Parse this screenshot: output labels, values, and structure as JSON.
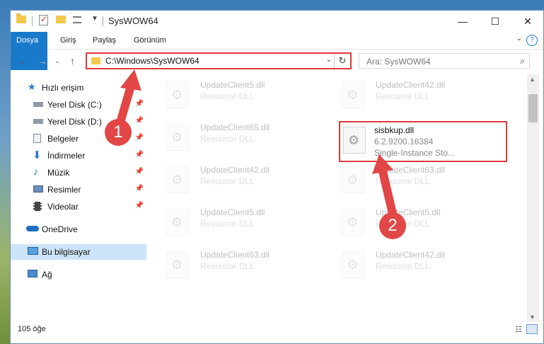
{
  "window": {
    "title": "SysWOW64"
  },
  "ribbon": {
    "tabs": [
      "Dosya",
      "Giriş",
      "Paylaş",
      "Görünüm"
    ]
  },
  "nav": {
    "address": "C:\\Windows\\SysWOW64",
    "search_placeholder": "Ara: SysWOW64"
  },
  "sidebar": {
    "quick_access": "Hızlı erişim",
    "items": [
      {
        "label": "Yerel Disk (C:)",
        "icon": "drive-icon"
      },
      {
        "label": "Yerel Disk (D:)",
        "icon": "drive-icon"
      },
      {
        "label": "Belgeler",
        "icon": "documents-icon"
      },
      {
        "label": "İndirmeler",
        "icon": "download-icon"
      },
      {
        "label": "Müzik",
        "icon": "music-icon"
      },
      {
        "label": "Resimler",
        "icon": "pictures-icon"
      },
      {
        "label": "Videolar",
        "icon": "video-icon"
      }
    ],
    "onedrive": "OneDrive",
    "this_pc": "Bu bilgisayar",
    "network": "Ağ"
  },
  "files": {
    "left": [
      {
        "name": "UpdateClient5.dll",
        "desc": "Resource DLL"
      },
      {
        "name": "UpdateClient65.dll",
        "desc": "Resource DLL"
      },
      {
        "name": "UpdateClient42.dll",
        "desc": "Resource DLL"
      },
      {
        "name": "UpdateClient5.dll",
        "desc": "Resource DLL"
      },
      {
        "name": "UpdateClient63.dll",
        "desc": "Resource DLL"
      }
    ],
    "right": [
      {
        "name": "UpdateClient42.dll",
        "desc": "Resource DLL"
      },
      {
        "name": "UpdateClient63.dll",
        "desc": "Resource DLL"
      },
      {
        "name": "UpdateClient5.dll",
        "desc": "Resource DLL"
      },
      {
        "name": "UpdateClient42.dll",
        "desc": "Resource DLL"
      }
    ],
    "highlighted": {
      "name": "sisbkup.dll",
      "version": "6.2.9200.16384",
      "desc": "Single-Instance Sto..."
    }
  },
  "status": {
    "count": "105 öğe"
  },
  "annotations": {
    "step1": "1",
    "step2": "2",
    "color": "#e24646"
  }
}
